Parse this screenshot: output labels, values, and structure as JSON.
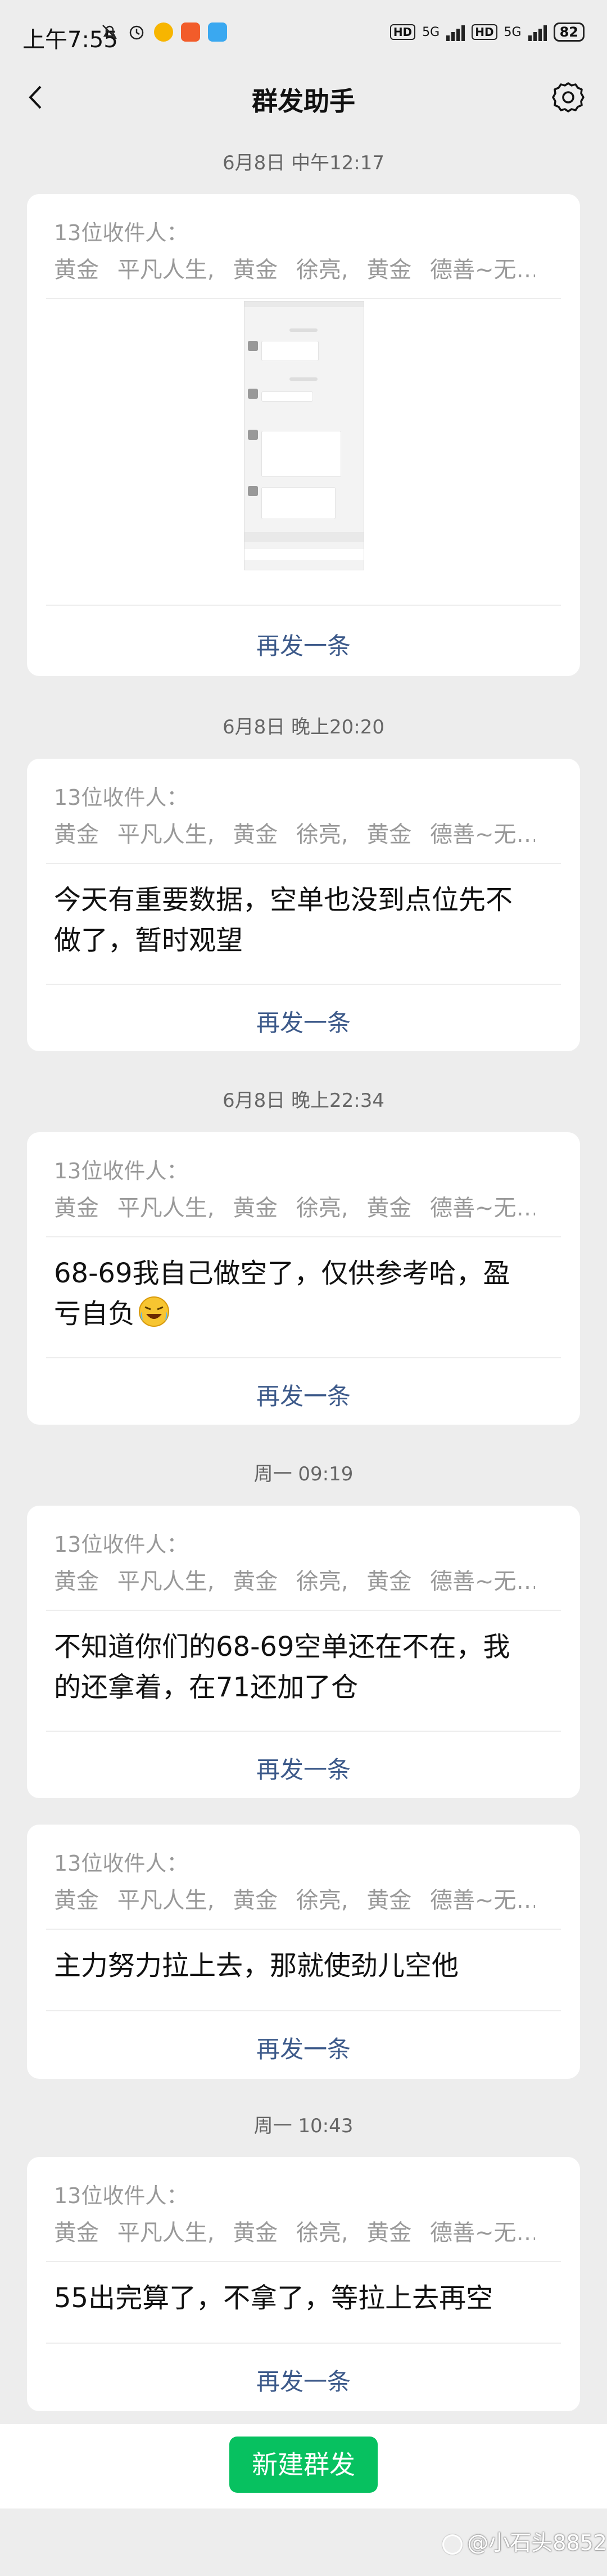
{
  "status_bar": {
    "time": "上午7:55",
    "hd1": "HD",
    "net1": "5G",
    "hd2": "HD",
    "net2": "5G",
    "battery": "82"
  },
  "nav": {
    "title": "群发助手"
  },
  "messages": [
    {
      "timestamp": "6月8日 中午12:17",
      "recipients_label": "13位收件人：",
      "recipients": "黄金  平凡人生, 黄金  徐亮, 黄金  德善~无…",
      "resend": "再发一条"
    },
    {
      "timestamp": "6月8日 晚上20:20",
      "recipients_label": "13位收件人：",
      "recipients": "黄金  平凡人生, 黄金  徐亮, 黄金  德善~无…",
      "text_line1": "今天有重要数据，空单也没到点位先不",
      "text_line2": "做了，暂时观望",
      "resend": "再发一条"
    },
    {
      "timestamp": "6月8日 晚上22:34",
      "recipients_label": "13位收件人：",
      "recipients": "黄金  平凡人生, 黄金  徐亮, 黄金  德善~无…",
      "text_line1": "68-69我自己做空了，仅供参考哈，盈",
      "text_line2": "亏自负",
      "resend": "再发一条"
    },
    {
      "timestamp": "周一 09:19",
      "recipients_label": "13位收件人：",
      "recipients": "黄金  平凡人生, 黄金  徐亮, 黄金  德善~无…",
      "text_line1": "不知道你们的68-69空单还在不在，我",
      "text_line2": "的还拿着，在71还加了仓",
      "resend": "再发一条"
    },
    {
      "recipients_label": "13位收件人：",
      "recipients": "黄金  平凡人生, 黄金  徐亮, 黄金  德善~无…",
      "text_line1": "主力努力拉上去，那就使劲儿空他",
      "resend": "再发一条"
    },
    {
      "timestamp": "周一 10:43",
      "recipients_label": "13位收件人：",
      "recipients": "黄金  平凡人生, 黄金  徐亮, 黄金  德善~无…",
      "text_line1": "55出完算了，不拿了，等拉上去再空",
      "resend": "再发一条"
    }
  ],
  "bottom": {
    "new_button": "新建群发"
  },
  "watermark": "@小石头8852",
  "colors": {
    "accent_green": "#07c160",
    "link_blue": "#3d5a8a",
    "background": "#ededed"
  }
}
